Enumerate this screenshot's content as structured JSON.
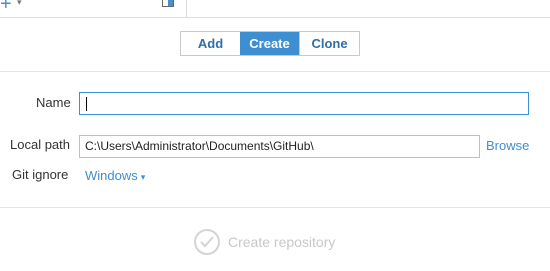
{
  "header": {
    "add_icon": "plus-icon",
    "menu_caret_icon": "caret-down-icon",
    "panel_icon": "panel-toggle-icon"
  },
  "tabs": [
    {
      "label": "Add",
      "selected": false
    },
    {
      "label": "Create",
      "selected": true
    },
    {
      "label": "Clone",
      "selected": false
    }
  ],
  "form": {
    "name_label": "Name",
    "name_value": "",
    "local_path_label": "Local path",
    "local_path_value": "C:\\Users\\Administrator\\Documents\\GitHub\\",
    "browse_label": "Browse",
    "git_ignore_label": "Git ignore",
    "git_ignore_value": "Windows",
    "git_ignore_arrow": "▾"
  },
  "footer": {
    "create_button_label": "Create repository",
    "create_button_enabled": false,
    "create_button_icon": "checkmark-circle-icon"
  },
  "colors": {
    "accent": "#3d8fd1",
    "link": "#3d8fd1",
    "disabled": "#c8c8c8"
  }
}
